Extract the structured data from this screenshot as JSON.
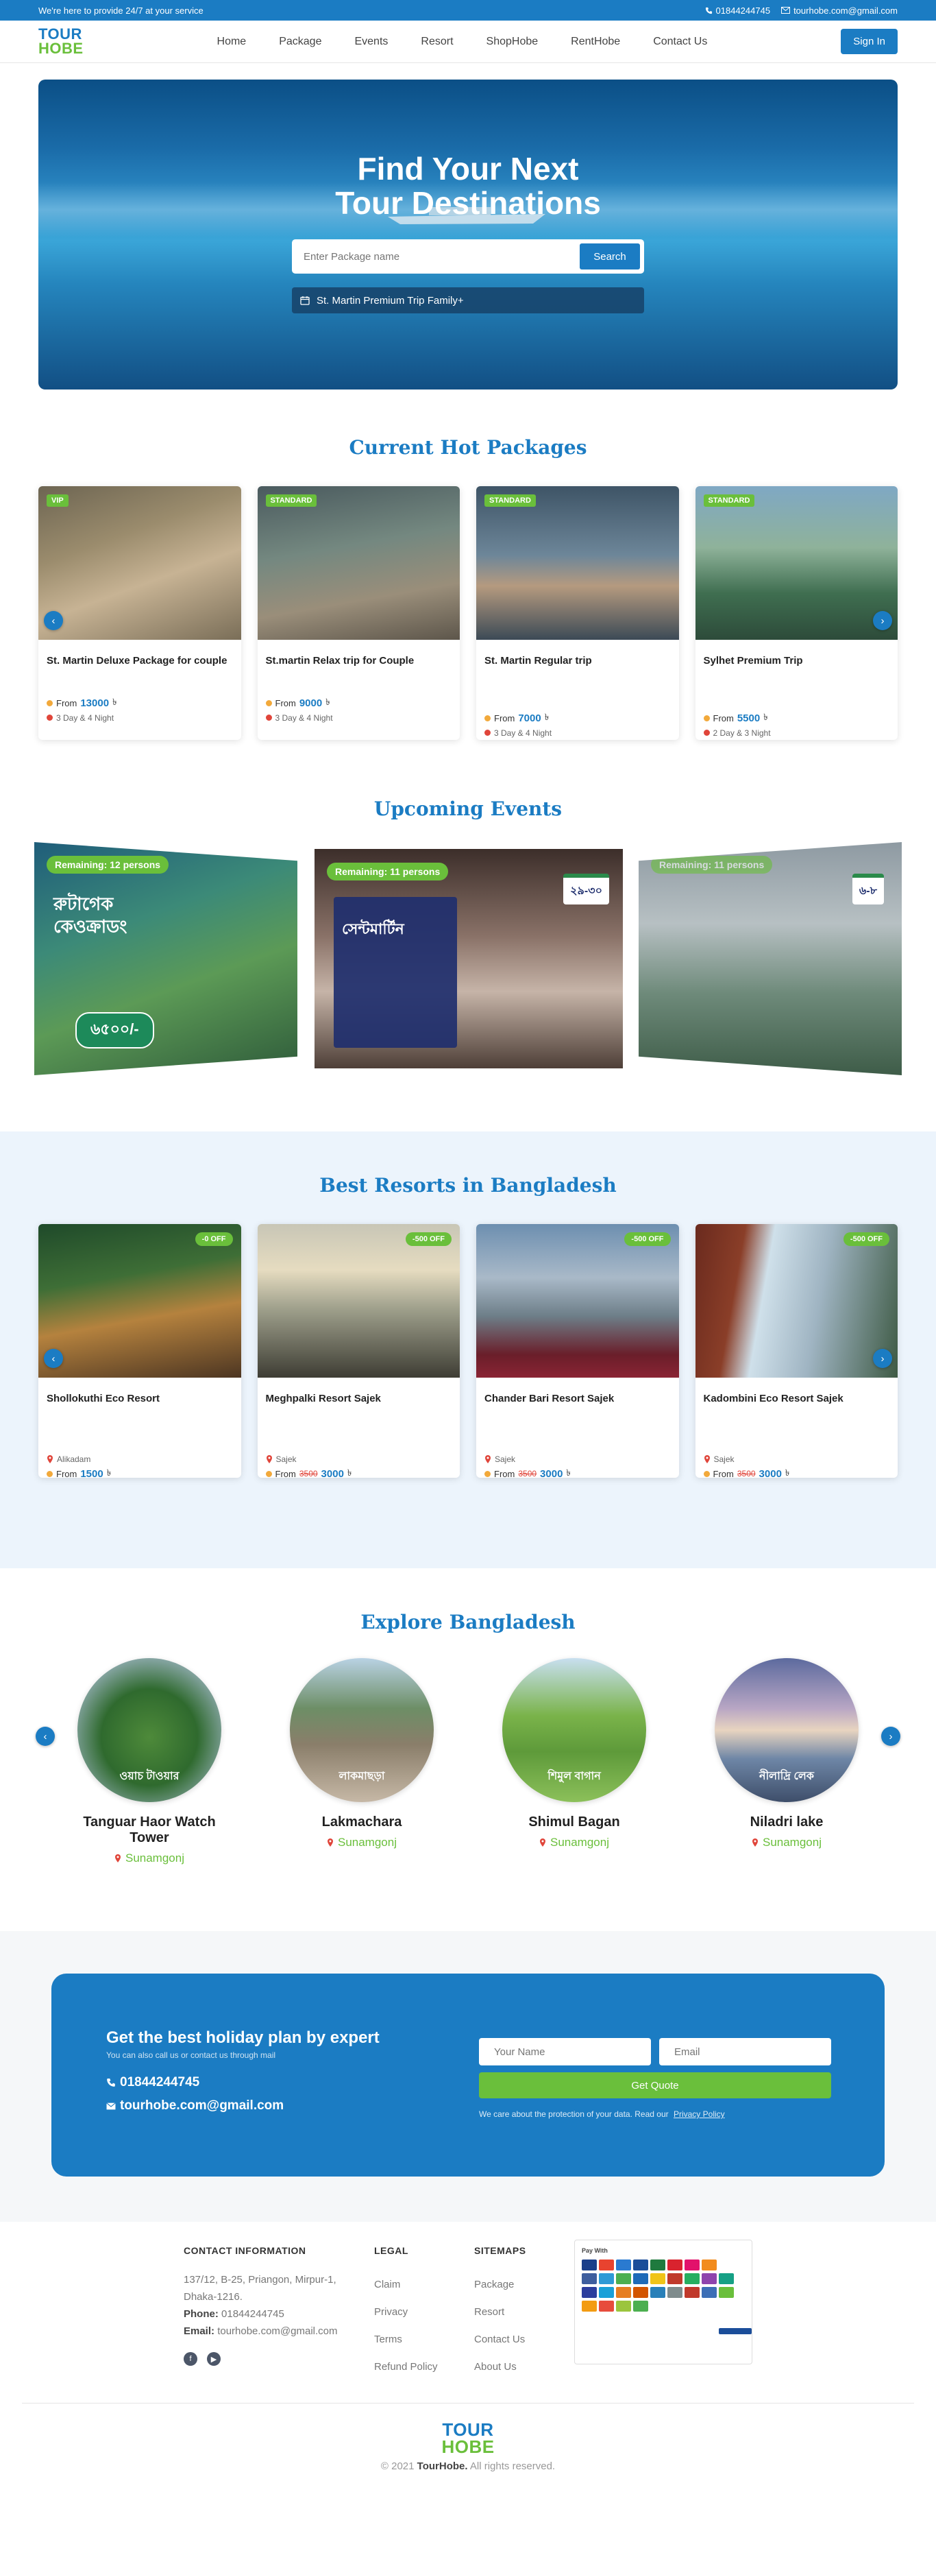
{
  "topbar": {
    "tagline": "We're here to provide 24/7 at your service",
    "phone": "01844244745",
    "email": "tourhobe.com@gmail.com"
  },
  "brand": {
    "line1": "TOUR",
    "line2": "HOBE"
  },
  "nav": {
    "links": [
      "Home",
      "Package",
      "Events",
      "Resort",
      "ShopHobe",
      "RentHobe",
      "Contact Us"
    ],
    "signin": "Sign In"
  },
  "hero": {
    "title_line1": "Find Your Next",
    "title_line2": "Tour Destinations",
    "search_placeholder": "Enter Package name",
    "search_button": "Search",
    "suggestion": "St. Martin Premium Trip Family+"
  },
  "packages": {
    "title": "Current Hot Packages",
    "items": [
      {
        "tag": "VIP",
        "name": "St. Martin Deluxe Package for couple",
        "from_label": "From",
        "price": "13000",
        "currency": "৳",
        "duration": "3 Day & 4 Night"
      },
      {
        "tag": "STANDARD",
        "name": "St.martin Relax trip for Couple",
        "from_label": "From",
        "price": "9000",
        "currency": "৳",
        "duration": "3 Day & 4 Night"
      },
      {
        "tag": "STANDARD",
        "name": "St. Martin Regular trip",
        "from_label": "From",
        "price": "7000",
        "currency": "৳",
        "duration": "3 Day & 4 Night"
      },
      {
        "tag": "STANDARD",
        "name": "Sylhet Premium Trip",
        "from_label": "From",
        "price": "5500",
        "currency": "৳",
        "duration": "2 Day & 3 Night"
      }
    ]
  },
  "events": {
    "title": "Upcoming Events",
    "items": [
      {
        "remaining": "Remaining: 12 persons",
        "poster_title": "রুটাগেক কেওক্রাডং",
        "price_badge": "৬৫০০/-"
      },
      {
        "remaining": "Remaining: 11 persons",
        "poster_title": "সেন্টমার্টিন",
        "date_badge": "২৯-৩০"
      },
      {
        "remaining": "Remaining: 11 persons",
        "date_badge": "৬-৮"
      }
    ]
  },
  "resorts": {
    "title": "Best Resorts in Bangladesh",
    "items": [
      {
        "discount": "-0 OFF",
        "name": "Shollokuthi Eco Resort",
        "location": "Alikadam",
        "from_label": "From",
        "old_price": "",
        "price": "1500",
        "currency": "৳"
      },
      {
        "discount": "-500 OFF",
        "name": "Meghpalki Resort Sajek",
        "location": "Sajek",
        "from_label": "From",
        "old_price": "3500",
        "price": "3000",
        "currency": "৳"
      },
      {
        "discount": "-500 OFF",
        "name": "Chander Bari Resort Sajek",
        "location": "Sajek",
        "from_label": "From",
        "old_price": "3500",
        "price": "3000",
        "currency": "৳"
      },
      {
        "discount": "-500 OFF",
        "name": "Kadombini Eco Resort Sajek",
        "location": "Sajek",
        "from_label": "From",
        "old_price": "3500",
        "price": "3000",
        "currency": "৳"
      }
    ]
  },
  "explore": {
    "title": "Explore Bangladesh",
    "items": [
      {
        "caption": "ওয়াচ টাওয়ার",
        "name": "Tanguar Haor Watch Tower",
        "location": "Sunamgonj"
      },
      {
        "caption": "লাকমাছড়া",
        "name": "Lakmachara",
        "location": "Sunamgonj"
      },
      {
        "caption": "শিমুল বাগান",
        "name": "Shimul Bagan",
        "location": "Sunamgonj"
      },
      {
        "caption": "নীলাদ্রি লেক",
        "name": "Niladri lake",
        "location": "Sunamgonj"
      }
    ]
  },
  "cta": {
    "heading": "Get the best holiday plan by expert",
    "sub": "You can also call us or contact us through mail",
    "phone": "01844244745",
    "email": "tourhobe.com@gmail.com",
    "name_placeholder": "Your Name",
    "email_placeholder": "Email",
    "button": "Get Quote",
    "privacy_text": "We care about the protection of your data. Read our",
    "privacy_link": "Privacy Policy"
  },
  "footer": {
    "contact": {
      "heading": "CONTACT INFORMATION",
      "address_line1": "137/12, B-25, Priangon, Mirpur-1,",
      "address_line2": "Dhaka-1216.",
      "phone_label": "Phone:",
      "phone": "01844244745",
      "email_label": "Email:",
      "email": "tourhobe.com@gmail.com"
    },
    "legal": {
      "heading": "LEGAL",
      "links": [
        "Claim",
        "Privacy",
        "Terms",
        "Refund Policy"
      ]
    },
    "sitemaps": {
      "heading": "SITEMAPS",
      "links": [
        "Package",
        "Resort",
        "Contact Us",
        "About Us"
      ]
    },
    "payment": {
      "heading": "Pay With"
    },
    "copyright_prefix": "© 2021",
    "copyright_brand": "TourHobe.",
    "copyright_suffix": "All rights reserved."
  },
  "colors": {
    "primary": "#1b7cc3",
    "accent_green": "#6abf3b",
    "resort_bg": "#ecf4fc"
  }
}
